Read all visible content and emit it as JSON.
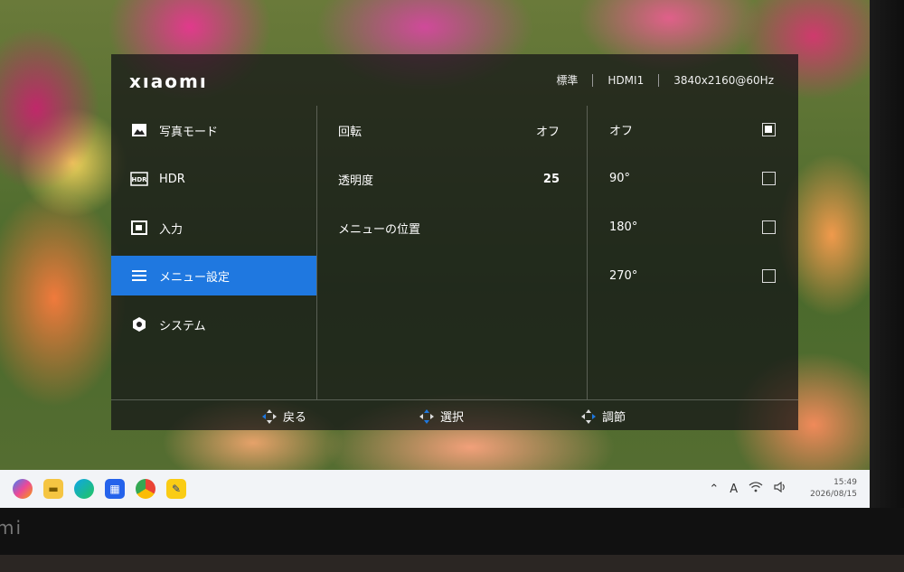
{
  "osd": {
    "brand": "xıaomı",
    "status": {
      "mode": "標準",
      "input": "HDMI1",
      "resolution": "3840x2160@60Hz"
    },
    "sidebar": {
      "items": [
        {
          "label": "写真モード",
          "icon": "image-icon",
          "active": false
        },
        {
          "label": "HDR",
          "icon": "hdr-icon",
          "active": false
        },
        {
          "label": "入力",
          "icon": "input-icon",
          "active": false
        },
        {
          "label": "メニュー設定",
          "icon": "menu-icon",
          "active": true
        },
        {
          "label": "システム",
          "icon": "system-gear-icon",
          "active": false
        }
      ]
    },
    "options": [
      {
        "label": "回転",
        "value": "オフ"
      },
      {
        "label": "透明度",
        "value": "25"
      },
      {
        "label": "メニューの位置",
        "value": ""
      }
    ],
    "values": [
      {
        "label": "オフ",
        "checked": true
      },
      {
        "label": "90°",
        "checked": false
      },
      {
        "label": "180°",
        "checked": false
      },
      {
        "label": "270°",
        "checked": false
      }
    ],
    "footer": {
      "back": "戻る",
      "select": "選択",
      "adjust": "調節"
    }
  },
  "taskbar": {
    "clock_time": "15:49",
    "clock_date": "2026/08/15",
    "ime": "A"
  },
  "bezel": {
    "logo": "mi"
  }
}
